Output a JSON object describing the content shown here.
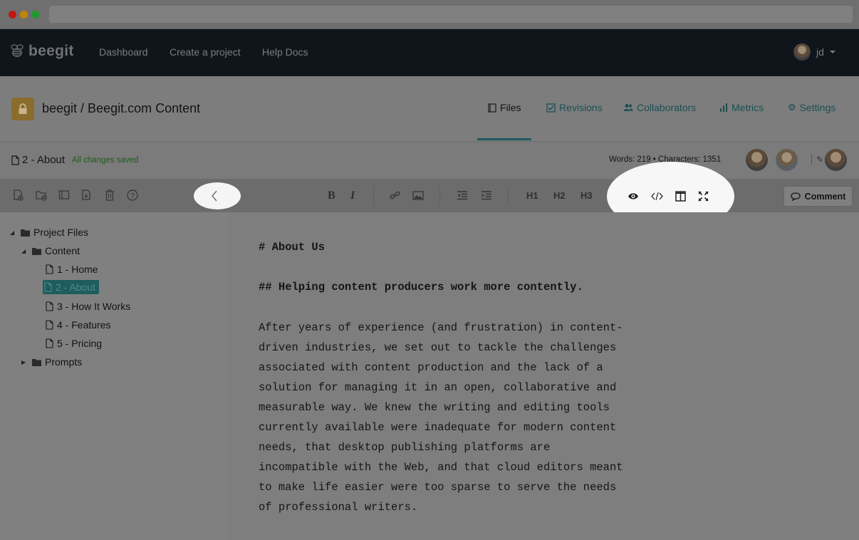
{
  "nav": {
    "brand": "beegit",
    "links": [
      "Dashboard",
      "Create a project",
      "Help Docs"
    ],
    "user": "jd"
  },
  "project": {
    "title": "beegit / Beegit.com Content",
    "tabs": [
      "Files",
      "Revisions",
      "Collaborators",
      "Metrics",
      "Settings"
    ]
  },
  "file": {
    "name": "2 - About",
    "status": "All changes saved",
    "counts": "Words: 219  •  Characters: 1351"
  },
  "toolbar": {
    "bold": "B",
    "italic": "I",
    "h1": "H1",
    "h2": "H2",
    "h3": "H3",
    "comment": "Comment"
  },
  "tree": {
    "root": "Project Files",
    "content": "Content",
    "files": [
      "1 - Home",
      "2 - About",
      "3 - How It Works",
      "4 - Features",
      "5 - Pricing"
    ],
    "prompts": "Prompts"
  },
  "editor": {
    "h1": "# About Us",
    "h2": "## Helping content producers work more contently.",
    "para_lines": [
      "After years of experience (and frustration) in content-",
      "driven industries, we set out to tackle the challenges",
      "associated with content production and the lack of a",
      "solution for managing it in an open, collaborative and",
      "measurable way. We knew the writing and editing tools",
      "currently available were inadequate for modern content",
      "needs, that desktop publishing platforms are",
      "incompatible with the Web, and that cloud editors meant",
      "to make life easier were too sparse to serve the needs",
      "of professional writers."
    ]
  },
  "colors": {
    "accent": "#1e5a5e",
    "saved": "#22571f",
    "lock": "#8a6d2c"
  }
}
